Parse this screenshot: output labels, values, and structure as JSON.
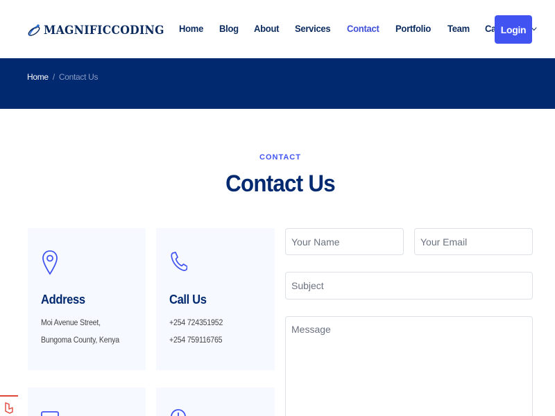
{
  "brand": {
    "name": "MAGNIFICCODING"
  },
  "nav": {
    "items": [
      "Home",
      "Blog",
      "About",
      "Services",
      "Contact",
      "Portfolio",
      "Team"
    ],
    "categories_label": "Categories",
    "login_label": "Login"
  },
  "breadcrumb": {
    "home": "Home",
    "separator": "/",
    "current": "Contact Us"
  },
  "section": {
    "label": "CONTACT",
    "title": "Contact Us"
  },
  "cards": {
    "address": {
      "title": "Address",
      "lines": [
        "Moi Avenue Street,",
        "Bungoma County, Kenya"
      ]
    },
    "call": {
      "title": "Call Us",
      "lines": [
        "+254 724351952",
        "+254 759116765"
      ]
    }
  },
  "form": {
    "name_placeholder": "Your Name",
    "email_placeholder": "Your Email",
    "subject_placeholder": "Subject",
    "message_placeholder": "Message"
  },
  "colors": {
    "primary": "#4154f1",
    "navy": "#012970",
    "card_bg": "#f6f9ff"
  }
}
